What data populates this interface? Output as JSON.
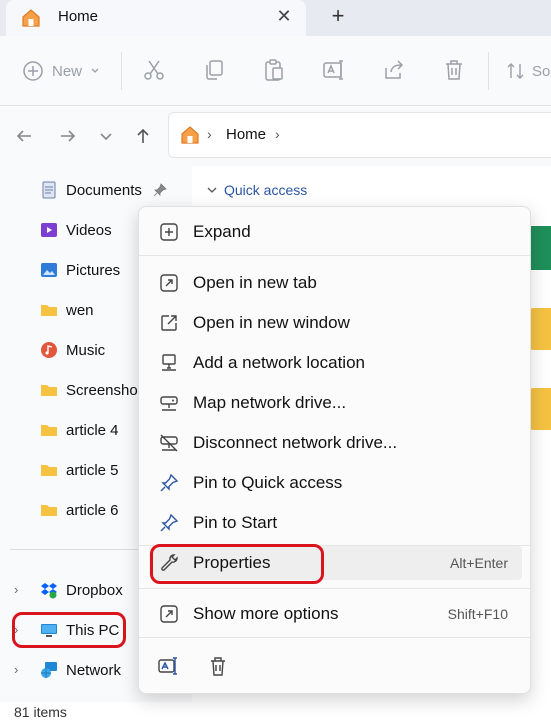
{
  "window": {
    "tab_title": "Home",
    "tab_close_glyph": "✕",
    "new_tab_glyph": "+"
  },
  "toolbar": {
    "new_label": "New",
    "sort_label": "So",
    "icons": [
      "cut-icon",
      "copy-icon",
      "paste-icon",
      "rename-icon",
      "share-icon",
      "delete-icon"
    ]
  },
  "address": {
    "separator": "›",
    "location": "Home"
  },
  "sidebar": {
    "items": [
      {
        "label": "Documents",
        "icon": "documents-icon"
      },
      {
        "label": "Videos",
        "icon": "videos-icon"
      },
      {
        "label": "Pictures",
        "icon": "pictures-icon"
      },
      {
        "label": "wen",
        "icon": "folder-icon"
      },
      {
        "label": "Music",
        "icon": "music-icon"
      },
      {
        "label": "Screenshot",
        "icon": "folder-icon"
      },
      {
        "label": "article 4",
        "icon": "folder-icon"
      },
      {
        "label": "article 5",
        "icon": "folder-icon"
      },
      {
        "label": "article 6",
        "icon": "folder-icon"
      }
    ],
    "roots": [
      {
        "label": "Dropbox",
        "icon": "dropbox-icon"
      },
      {
        "label": "This PC",
        "icon": "this-pc-icon"
      },
      {
        "label": "Network",
        "icon": "network-icon"
      }
    ]
  },
  "content": {
    "section_label": "Quick access"
  },
  "status": {
    "item_count": "81 items"
  },
  "context_menu": {
    "items": [
      {
        "label": "Expand",
        "shortcut": ""
      },
      {
        "label": "Open in new tab",
        "shortcut": ""
      },
      {
        "label": "Open in new window",
        "shortcut": ""
      },
      {
        "label": "Add a network location",
        "shortcut": ""
      },
      {
        "label": "Map network drive...",
        "shortcut": ""
      },
      {
        "label": "Disconnect network drive...",
        "shortcut": ""
      },
      {
        "label": "Pin to Quick access",
        "shortcut": ""
      },
      {
        "label": "Pin to Start",
        "shortcut": ""
      },
      {
        "label": "Properties",
        "shortcut": "Alt+Enter"
      },
      {
        "label": "Show more options",
        "shortcut": "Shift+F10"
      }
    ],
    "highlighted_item": "Properties"
  },
  "colors": {
    "accent": "#2a56a6",
    "highlight_box": "#d9141c",
    "folder": "#f5c242"
  }
}
